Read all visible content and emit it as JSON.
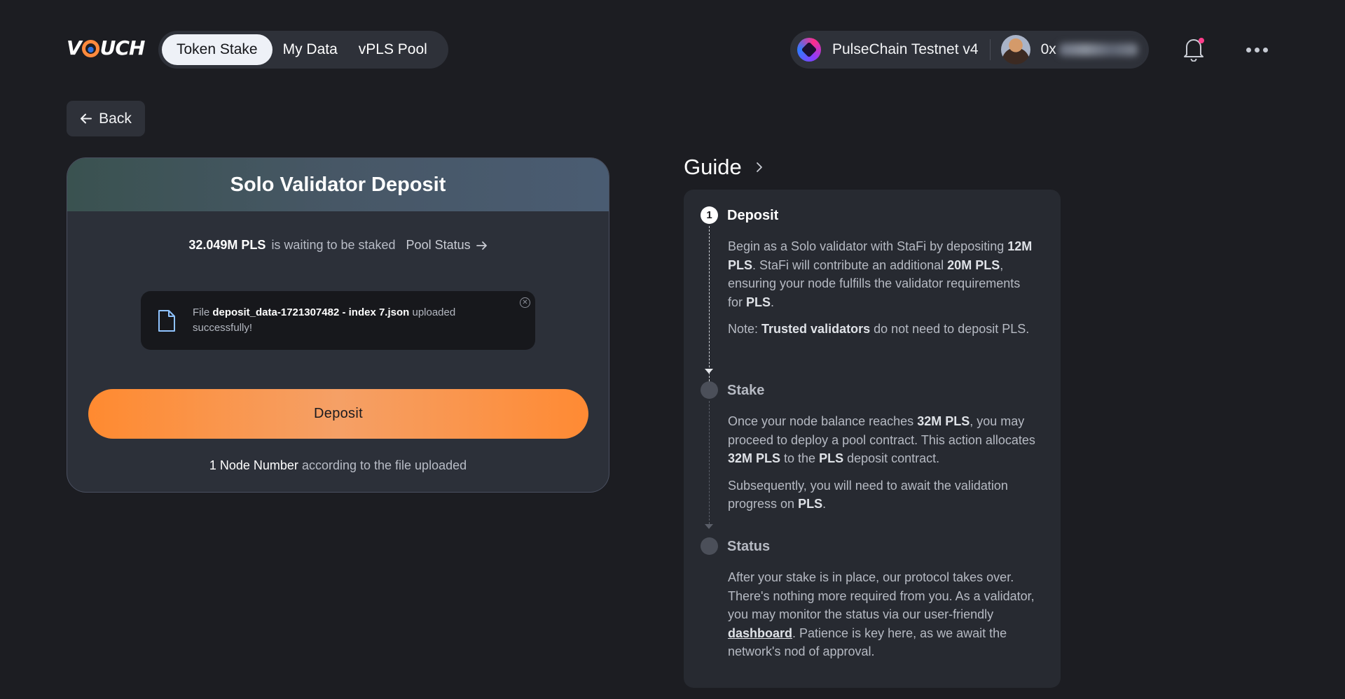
{
  "header": {
    "logo": "VOUCH",
    "tabs": [
      {
        "label": "Token Stake",
        "active": true
      },
      {
        "label": "My Data",
        "active": false
      },
      {
        "label": "vPLS Pool",
        "active": false
      }
    ],
    "network": "PulseChain Testnet v4",
    "address_prefix": "0x",
    "notification_dot_color": "#ff3d8b"
  },
  "back": {
    "label": "Back"
  },
  "deposit_card": {
    "title": "Solo Validator Deposit",
    "waiting_amount": "32.049M PLS",
    "waiting_text": "is waiting to be staked",
    "pool_status_label": "Pool Status",
    "file": {
      "prefix": "File",
      "name": "deposit_data-1721307482 - index 7.json",
      "suffix": "uploaded successfully!"
    },
    "deposit_button": "Deposit",
    "node_count": "1 Node Number",
    "node_suffix": "according to the file uploaded",
    "accent_color": "#ff8a30"
  },
  "guide": {
    "title": "Guide",
    "steps": [
      {
        "number": "1",
        "title": "Deposit",
        "para1": [
          {
            "t": "Begin as a Solo validator with StaFi by depositing "
          },
          {
            "t": "12M PLS",
            "b": true
          },
          {
            "t": ". StaFi will contribute an additional "
          },
          {
            "t": "20M PLS",
            "b": true
          },
          {
            "t": ", ensuring your node fulfills the validator requirements for "
          },
          {
            "t": "PLS",
            "b": true
          },
          {
            "t": "."
          }
        ],
        "para2": [
          {
            "t": "Note: "
          },
          {
            "t": "Trusted validators",
            "b": true
          },
          {
            "t": " do not need to deposit PLS."
          }
        ]
      },
      {
        "title": "Stake",
        "para1": [
          {
            "t": "Once your node balance reaches "
          },
          {
            "t": "32M PLS",
            "b": true
          },
          {
            "t": ", you may proceed to deploy a pool contract. This action allocates "
          },
          {
            "t": "32M PLS",
            "b": true
          },
          {
            "t": " to the "
          },
          {
            "t": "PLS",
            "b": true
          },
          {
            "t": " deposit contract."
          }
        ],
        "para2": [
          {
            "t": "Subsequently, you will need to await the validation progress on "
          },
          {
            "t": "PLS",
            "b": true
          },
          {
            "t": "."
          }
        ]
      },
      {
        "title": "Status",
        "para1": [
          {
            "t": "After your stake is in place, our protocol takes over. There's nothing more required from you. As a validator, you may monitor the status via our user-friendly "
          },
          {
            "t": "dashboard",
            "link": true
          },
          {
            "t": ". Patience is key here, as we await the network's nod of approval."
          }
        ]
      }
    ]
  }
}
